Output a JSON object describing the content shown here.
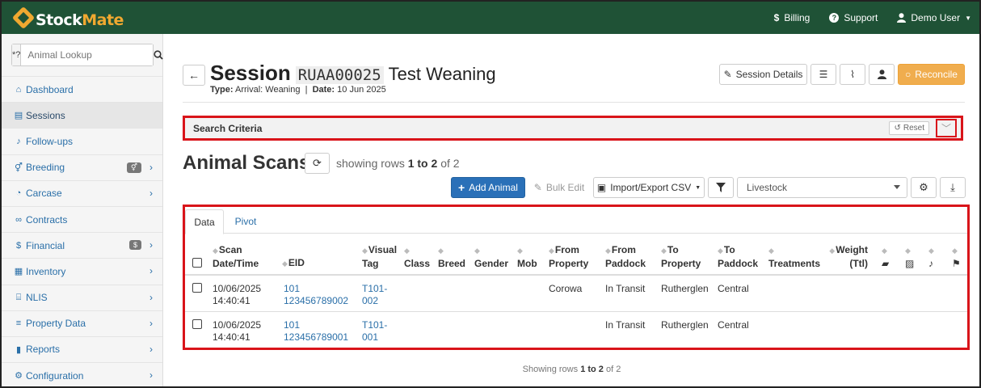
{
  "navbar": {
    "logo_prefix": "Stock",
    "logo_suffix": "Mate",
    "billing_label": "Billing",
    "support_label": "Support",
    "user_label": "Demo User"
  },
  "sidebar": {
    "lookup_prefix": "*?",
    "lookup_placeholder": "Animal Lookup",
    "items": [
      {
        "label": "Dashboard",
        "icon": "home-icon"
      },
      {
        "label": "Sessions",
        "icon": "table-icon"
      },
      {
        "label": "Follow-ups",
        "icon": "bell-icon"
      },
      {
        "label": "Breeding",
        "icon": "gender-icon"
      },
      {
        "label": "Carcase",
        "icon": "carcase-icon"
      },
      {
        "label": "Contracts",
        "icon": "handshake-icon"
      },
      {
        "label": "Financial",
        "icon": "dollar-icon",
        "badge": "$"
      },
      {
        "label": "Inventory",
        "icon": "boxes-icon"
      },
      {
        "label": "NLIS",
        "icon": "bank-icon"
      },
      {
        "label": "Property Data",
        "icon": "sliders-icon"
      },
      {
        "label": "Reports",
        "icon": "chart-icon"
      },
      {
        "label": "Configuration",
        "icon": "gear-icon"
      }
    ]
  },
  "session": {
    "title": "Session",
    "code": "RUAA00025",
    "name": "Test Weaning",
    "type_label": "Type:",
    "type_value": "Arrival: Weaning",
    "date_label": "Date:",
    "date_value": "10 Jun 2025",
    "details_label": "Session Details",
    "reconcile_label": "Reconcile"
  },
  "search_criteria": {
    "label": "Search Criteria",
    "reset_label": "Reset"
  },
  "scans": {
    "title": "Animal Scans",
    "showing_prefix": "showing rows",
    "showing_range": "1 to 2",
    "showing_suffix": "of 2",
    "add_label": "Add Animal",
    "bulk_label": "Bulk Edit",
    "csv_label": "Import/Export CSV",
    "view_select": "Livestock"
  },
  "table": {
    "tabs": [
      "Data",
      "Pivot"
    ],
    "headers": {
      "scan_l1": "Scan",
      "scan_l2": "Date/Time",
      "eid": "EID",
      "visual_l1": "Visual",
      "visual_l2": "Tag",
      "class": "Class",
      "breed": "Breed",
      "gender": "Gender",
      "mob": "Mob",
      "from_prop_l1": "From",
      "from_prop_l2": "Property",
      "from_pad_l1": "From",
      "from_pad_l2": "Paddock",
      "to_prop_l1": "To",
      "to_prop_l2": "Property",
      "to_pad_l1": "To",
      "to_pad_l2": "Paddock",
      "treatments": "Treatments",
      "weight_l1": "Weight",
      "weight_l2": "(Ttl)"
    },
    "rows": [
      {
        "date": "10/06/2025",
        "time": "14:40:41",
        "eid_l1": "101",
        "eid_l2": "123456789002",
        "tag_l1": "T101-",
        "tag_l2": "002",
        "from_property": "Corowa",
        "from_paddock": "In Transit",
        "to_property": "Rutherglen",
        "to_paddock": "Central"
      },
      {
        "date": "10/06/2025",
        "time": "14:40:41",
        "eid_l1": "101",
        "eid_l2": "123456789001",
        "tag_l1": "T101-",
        "tag_l2": "001",
        "from_property": "",
        "from_paddock": "In Transit",
        "to_property": "Rutherglen",
        "to_paddock": "Central"
      }
    ]
  },
  "footer": {
    "prefix": "Showing rows",
    "range": "1 to 2",
    "suffix": "of 2"
  },
  "colors": {
    "navbar": "#1f5236",
    "accent": "#f0ad4e",
    "primary": "#2a70b8",
    "highlight": "#d9141a"
  }
}
